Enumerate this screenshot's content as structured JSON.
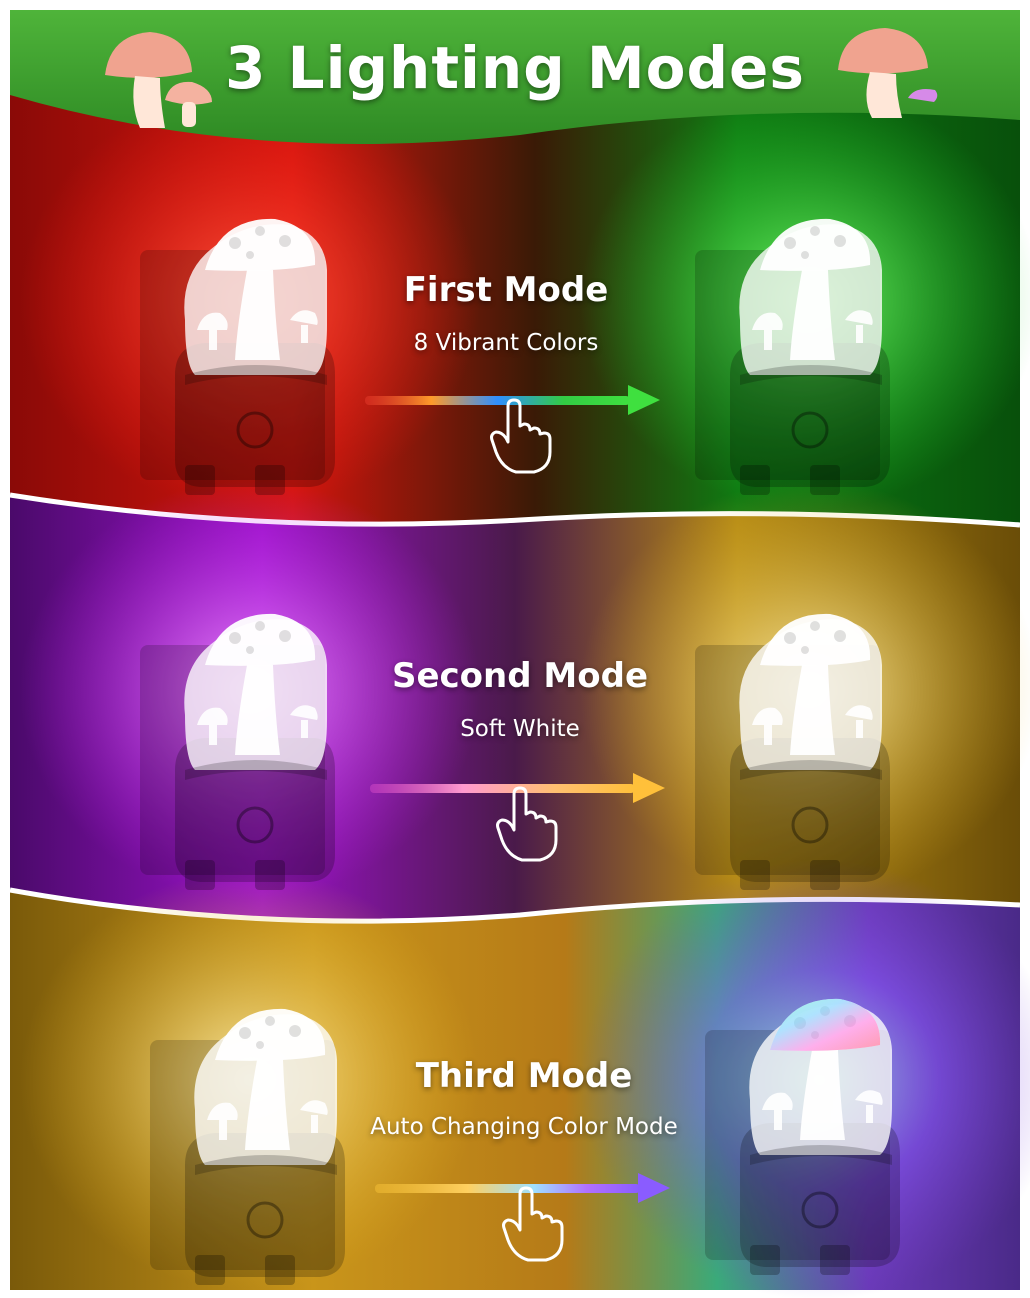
{
  "banner": {
    "title": "3 Lighting Modes",
    "color": "#3f9a2e"
  },
  "modes": [
    {
      "title": "First Mode",
      "subtitle": "8 Vibrant Colors",
      "left_glow": "#ff1a10",
      "right_glow": "#1fd12a",
      "arrow_colors": [
        "#ff4a3a",
        "#ff9a2a",
        "#2f8fff",
        "#33cc44",
        "#3fe03f"
      ]
    },
    {
      "title": "Second Mode",
      "subtitle": "Soft White",
      "left_glow": "#c21ff0",
      "right_glow": "#e0b221",
      "arrow_colors": [
        "#ff5fd8",
        "#ff9ad0",
        "#ffc070",
        "#ffc03a"
      ]
    },
    {
      "title": "Third Mode",
      "subtitle": "Auto Changing Color Mode",
      "left_glow": "#e5b41f",
      "right_glow": "#7a3fd0",
      "arrow_colors": [
        "#ffc93a",
        "#ffd060",
        "#9fe0ff",
        "#b070ff",
        "#8a5cff"
      ]
    }
  ]
}
